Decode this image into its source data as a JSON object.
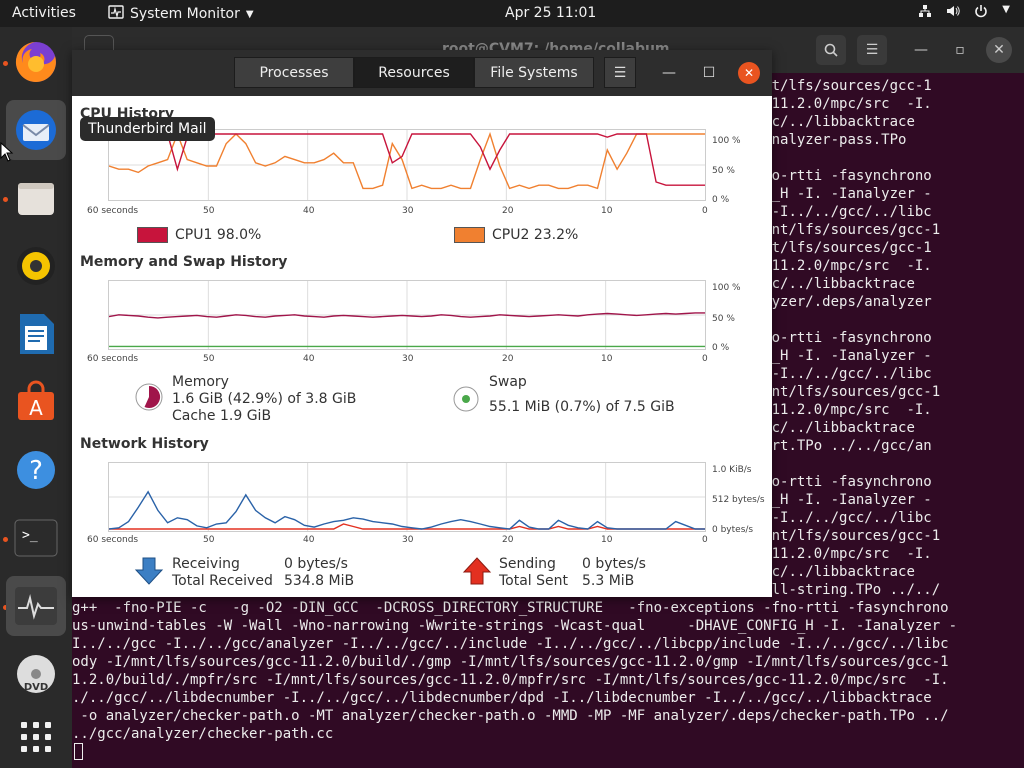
{
  "topbar": {
    "activities": "Activities",
    "app_name": "System Monitor",
    "clock": "Apr 25  11:01"
  },
  "tooltip": "Thunderbird Mail",
  "terminal": {
    "title": "root@CVM7: /home/collabum",
    "lines": [
      "                                                                            p -I/mnt/lfs/sources/gcc-1",
      "                                                                            es/gcc-11.2.0/mpc/src  -I.",
      "                                                                            ./../gcc/../libbacktrace",
      "                                                                            .deps/analyzer-pass.TPo",
      "",
      "                                                                            ons -fno-rtti -fasynchrono",
      "                                                                            _CONFIG_H -I. -Ianalyzer -",
      "                                                                            nclude -I../../gcc/../libc",
      "                                                                            mp -I/mnt/lfs/sources/gcc-1",
      "                                                                            p -I/mnt/lfs/sources/gcc-1",
      "                                                                            es/gcc-11.2.0/mpc/src  -I.",
      "                                                                            ./../gcc/../libbacktrace",
      "                                                                            MF analyzer/.deps/analyzer",
      "",
      "                                                                            ons -fno-rtti -fasynchrono",
      "                                                                            _CONFIG_H -I. -Ianalyzer -",
      "                                                                            nclude -I../../gcc/../libc",
      "                                                                            mp -I/mnt/lfs/sources/gcc-1",
      "                                                                            es/gcc-11.2.0/mpc/src  -I.",
      "                                                                            ./../gcc/../libbacktrace",
      "                                                                            bar-chart.TPo ../../gcc/an",
      "",
      "                                                                            ons -fno-rtti -fasynchrono",
      "                                                                            _CONFIG_H -I. -Ianalyzer -",
      "                                                                            nclude -I../../gcc/../libc",
      "                                                                            mp -I/mnt/lfs/sources/gcc-1",
      "                                                                            es/gcc-11.2.0/mpc/src  -I.",
      "                                                                            ./../gcc/../libbacktrace",
      "                                                                            deps/call-string.TPo ../../",
      "g++  -fno-PIE -c   -g -O2 -DIN_GCC  -DCROSS_DIRECTORY_STRUCTURE   -fno-exceptions -fno-rtti -fasynchrono",
      "us-unwind-tables -W -Wall -Wno-narrowing -Wwrite-strings -Wcast-qual     -DHAVE_CONFIG_H -I. -Ianalyzer -",
      "I../../gcc -I../../gcc/analyzer -I../../gcc/../include -I../../gcc/../libcpp/include -I../../gcc/../libc",
      "ody -I/mnt/lfs/sources/gcc-11.2.0/build/./gmp -I/mnt/lfs/sources/gcc-11.2.0/gmp -I/mnt/lfs/sources/gcc-1",
      "1.2.0/build/./mpfr/src -I/mnt/lfs/sources/gcc-11.2.0/mpfr/src -I/mnt/lfs/sources/gcc-11.2.0/mpc/src  -I.",
      "./../gcc/../libdecnumber -I../../gcc/../libdecnumber/dpd -I../libdecnumber -I../../gcc/../libbacktrace",
      " -o analyzer/checker-path.o -MT analyzer/checker-path.o -MMD -MP -MF analyzer/.deps/checker-path.TPo ../",
      "../gcc/analyzer/checker-path.cc"
    ]
  },
  "sysmon": {
    "tabs": [
      "Processes",
      "Resources",
      "File Systems"
    ],
    "selected_tab": "Resources",
    "cpu": {
      "title": "CPU History",
      "y_labels": [
        "100 %",
        "50 %",
        "0 %"
      ],
      "x_labels": [
        "60 seconds",
        "50",
        "40",
        "30",
        "20",
        "10",
        "0"
      ],
      "cpu1_label": "CPU1  98.0%",
      "cpu2_label": "CPU2  23.2%",
      "cpu1_color": "#c7143c",
      "cpu2_color": "#f08030",
      "cpu1_values": [
        100,
        100,
        100,
        100,
        100,
        100,
        100,
        45,
        95,
        100,
        100,
        100,
        100,
        100,
        100,
        100,
        100,
        100,
        100,
        100,
        100,
        100,
        100,
        100,
        100,
        100,
        100,
        100,
        100,
        55,
        65,
        100,
        100,
        100,
        100,
        100,
        100,
        100,
        80,
        45,
        75,
        100,
        100,
        100,
        100,
        100,
        100,
        100,
        100,
        100,
        100,
        95,
        100,
        100,
        100,
        100,
        25,
        20,
        20,
        20,
        20,
        20
      ],
      "cpu2_values": [
        50,
        45,
        45,
        40,
        50,
        55,
        60,
        100,
        60,
        55,
        50,
        50,
        85,
        100,
        85,
        55,
        50,
        55,
        65,
        60,
        55,
        55,
        60,
        70,
        55,
        55,
        15,
        15,
        20,
        85,
        60,
        15,
        20,
        15,
        15,
        20,
        15,
        15,
        60,
        100,
        50,
        15,
        20,
        15,
        20,
        20,
        15,
        15,
        20,
        20,
        15,
        75,
        45,
        70,
        100,
        100,
        100,
        100,
        100,
        100,
        100,
        100
      ]
    },
    "memory": {
      "title": "Memory and Swap History",
      "y_labels": [
        "100 %",
        "50 %",
        "0 %"
      ],
      "x_labels": [
        "60 seconds",
        "50",
        "40",
        "30",
        "20",
        "10",
        "0"
      ],
      "memory_label": "Memory",
      "memory_detail": "1.6 GiB (42.9%) of 3.8 GiB",
      "cache_detail": "Cache 1.9 GiB",
      "swap_label": "Swap",
      "swap_detail": "55.1 MiB (0.7%) of 7.5 GiB",
      "memory_values": [
        49,
        52,
        51,
        50,
        48,
        47,
        48,
        49,
        50,
        51,
        49,
        48,
        50,
        52,
        51,
        49,
        48,
        50,
        51,
        52,
        50,
        49,
        48,
        50,
        51,
        50,
        49,
        48,
        49,
        50,
        51,
        50,
        49,
        50,
        52,
        51,
        49,
        48,
        49,
        50,
        52,
        51,
        50,
        49,
        50,
        51,
        52,
        51,
        50,
        52,
        53,
        54,
        53,
        52,
        51,
        52,
        53,
        54,
        53,
        54,
        55,
        55
      ],
      "swap_values": [
        1,
        1,
        1,
        1,
        1,
        1,
        1,
        1,
        1,
        1,
        1,
        1,
        1,
        1,
        1,
        1,
        1,
        1,
        1,
        1,
        1,
        1,
        1,
        1,
        1,
        1,
        1,
        1,
        1,
        1,
        1,
        1,
        1,
        1,
        1,
        1,
        1,
        1,
        1,
        1,
        1,
        1,
        1,
        1,
        1,
        1,
        1,
        1,
        1,
        1,
        1,
        1,
        1,
        1,
        1,
        1,
        1,
        1,
        1,
        1,
        1,
        1
      ]
    },
    "network": {
      "title": "Network History",
      "y_labels": [
        "1.0 KiB/s",
        "512 bytes/s",
        "0 bytes/s"
      ],
      "x_labels": [
        "60 seconds",
        "50",
        "40",
        "30",
        "20",
        "10",
        "0"
      ],
      "receiving_label": "Receiving",
      "receiving_value": "0 bytes/s",
      "total_received_label": "Total Received",
      "total_received_value": "534.8 MiB",
      "sending_label": "Sending",
      "sending_value": "0 bytes/s",
      "total_sent_label": "Total Sent",
      "total_sent_value": "5.3 MiB",
      "recv_values": [
        0,
        2,
        12,
        35,
        60,
        30,
        10,
        18,
        15,
        5,
        2,
        8,
        10,
        28,
        55,
        30,
        18,
        10,
        20,
        15,
        6,
        3,
        8,
        12,
        14,
        18,
        16,
        12,
        10,
        8,
        4,
        2,
        0,
        3,
        8,
        12,
        15,
        12,
        8,
        4,
        2,
        0,
        14,
        3,
        0,
        0,
        14,
        6,
        2,
        0,
        12,
        2,
        0,
        0,
        0,
        0,
        0,
        0,
        12,
        6,
        0,
        0
      ],
      "send_values": [
        0,
        0,
        0,
        0,
        0,
        0,
        0,
        0,
        0,
        0,
        0,
        0,
        0,
        0,
        0,
        0,
        0,
        0,
        0,
        0,
        0,
        0,
        0,
        0,
        8,
        4,
        0,
        0,
        0,
        0,
        0,
        0,
        0,
        0,
        0,
        0,
        0,
        0,
        0,
        0,
        0,
        0,
        4,
        0,
        0,
        0,
        4,
        0,
        0,
        0,
        4,
        0,
        0,
        0,
        0,
        0,
        0,
        0,
        0,
        0,
        0,
        0
      ]
    }
  }
}
